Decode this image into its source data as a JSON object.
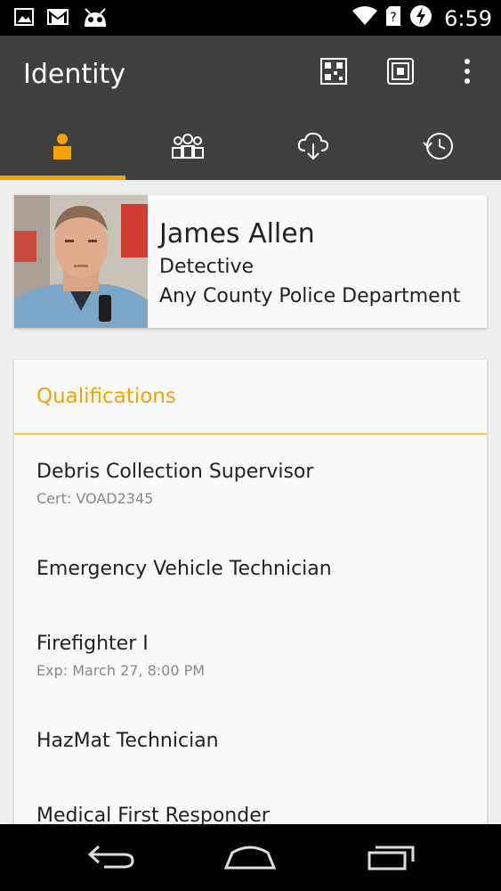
{
  "status_bar": {
    "time": "6:59",
    "icons": [
      "image-icon",
      "gmail-icon",
      "android-debug-icon",
      "wifi-icon",
      "sim-unknown-icon",
      "battery-charging-icon"
    ]
  },
  "app_bar": {
    "title": "Identity",
    "actions": [
      "qr-code-icon",
      "nfc-icon",
      "overflow-menu-icon"
    ]
  },
  "tabs": [
    {
      "icon": "person-icon",
      "selected": true
    },
    {
      "icon": "group-icon",
      "selected": false
    },
    {
      "icon": "cloud-download-icon",
      "selected": false
    },
    {
      "icon": "history-icon",
      "selected": false
    }
  ],
  "profile": {
    "name": "James Allen",
    "title": "Detective",
    "department": "Any County Police Department"
  },
  "qualifications": {
    "header": "Qualifications",
    "items": [
      {
        "name": "Debris Collection Supervisor",
        "detail": "Cert: VOAD2345"
      },
      {
        "name": "Emergency Vehicle Technician",
        "detail": ""
      },
      {
        "name": "Firefighter I",
        "detail": "Exp: March 27, 8:00 PM"
      },
      {
        "name": "HazMat Technician",
        "detail": ""
      },
      {
        "name": "Medical First Responder",
        "detail": ""
      }
    ]
  },
  "colors": {
    "accent": "#f4a300",
    "app_bar": "#404040",
    "background": "#eeeeee"
  }
}
